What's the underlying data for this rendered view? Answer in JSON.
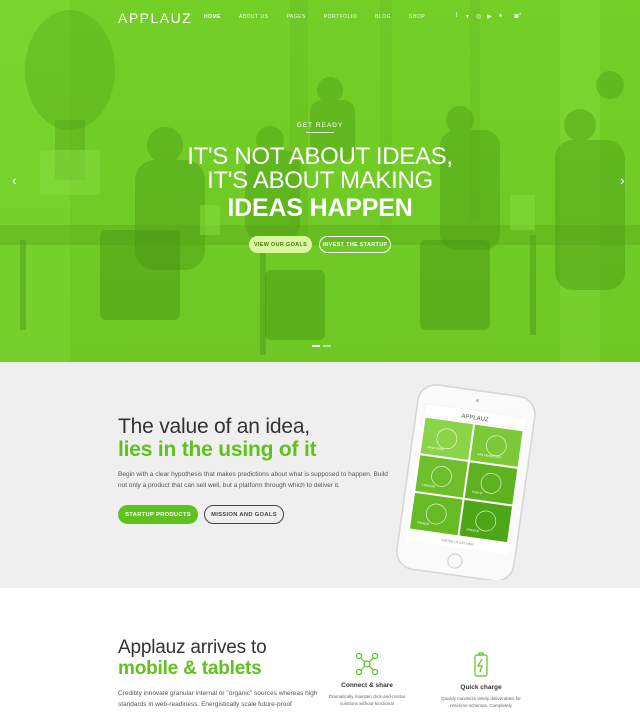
{
  "header": {
    "logo": "APPLAUZ",
    "nav": [
      "HOME",
      "ABOUT US",
      "PAGES",
      "PORTFOLIO",
      "BLOG",
      "SHOP"
    ],
    "social_icons": [
      "facebook-icon",
      "twitter-icon",
      "instagram-icon",
      "youtube-icon",
      "dribbble-icon"
    ],
    "cart_count": "0"
  },
  "hero": {
    "kicker": "GET READY",
    "headline_line1": "IT'S NOT ABOUT IDEAS,",
    "headline_line2": "IT'S ABOUT MAKING",
    "headline_strong": "IDEAS HAPPEN",
    "btn_primary": "VIEW OUR GOALS",
    "btn_secondary": "INVEST THE STARTUP",
    "prev_arrow": "‹",
    "next_arrow": "›"
  },
  "value": {
    "title": "The value of an idea,",
    "title_strong": "lies in the using of it",
    "text": "Begin with a clear hypothesis that makes predictions about what is supposed to happen. Build not only a product that can sell well, but a platform through which to deliver it.",
    "btn_primary": "STARTUP PRODUCTS",
    "btn_secondary": "MISSION AND GOALS",
    "phone_logo": "APPLAUZ",
    "phone_tiles": [
      "NEW YORK",
      "SAN FRANCISCO",
      "LONDON",
      "TOKYO",
      "FRANCE",
      "GREECE"
    ],
    "phone_button": "SWITCH TO LIST VIEW"
  },
  "arrives": {
    "title": "Applauz arrives to",
    "title_strong": "mobile & tablets",
    "text": "Credibly innovate granular internal or \"organic\" sources whereas high standards in web-readiness. Energistically scale future-proof",
    "features": [
      {
        "icon": "share-network-icon",
        "title": "Connect & share",
        "desc": "Dramatically maintain click-and-mortar solutions without functional"
      },
      {
        "icon": "battery-charge-icon",
        "title": "Quick charge",
        "desc": "Quickly maximize timely deliverables for real-time schemas. Completely"
      }
    ]
  },
  "colors": {
    "accent": "#5ec21d",
    "hero_green": "#6cc525",
    "section_gray": "#efefef"
  }
}
